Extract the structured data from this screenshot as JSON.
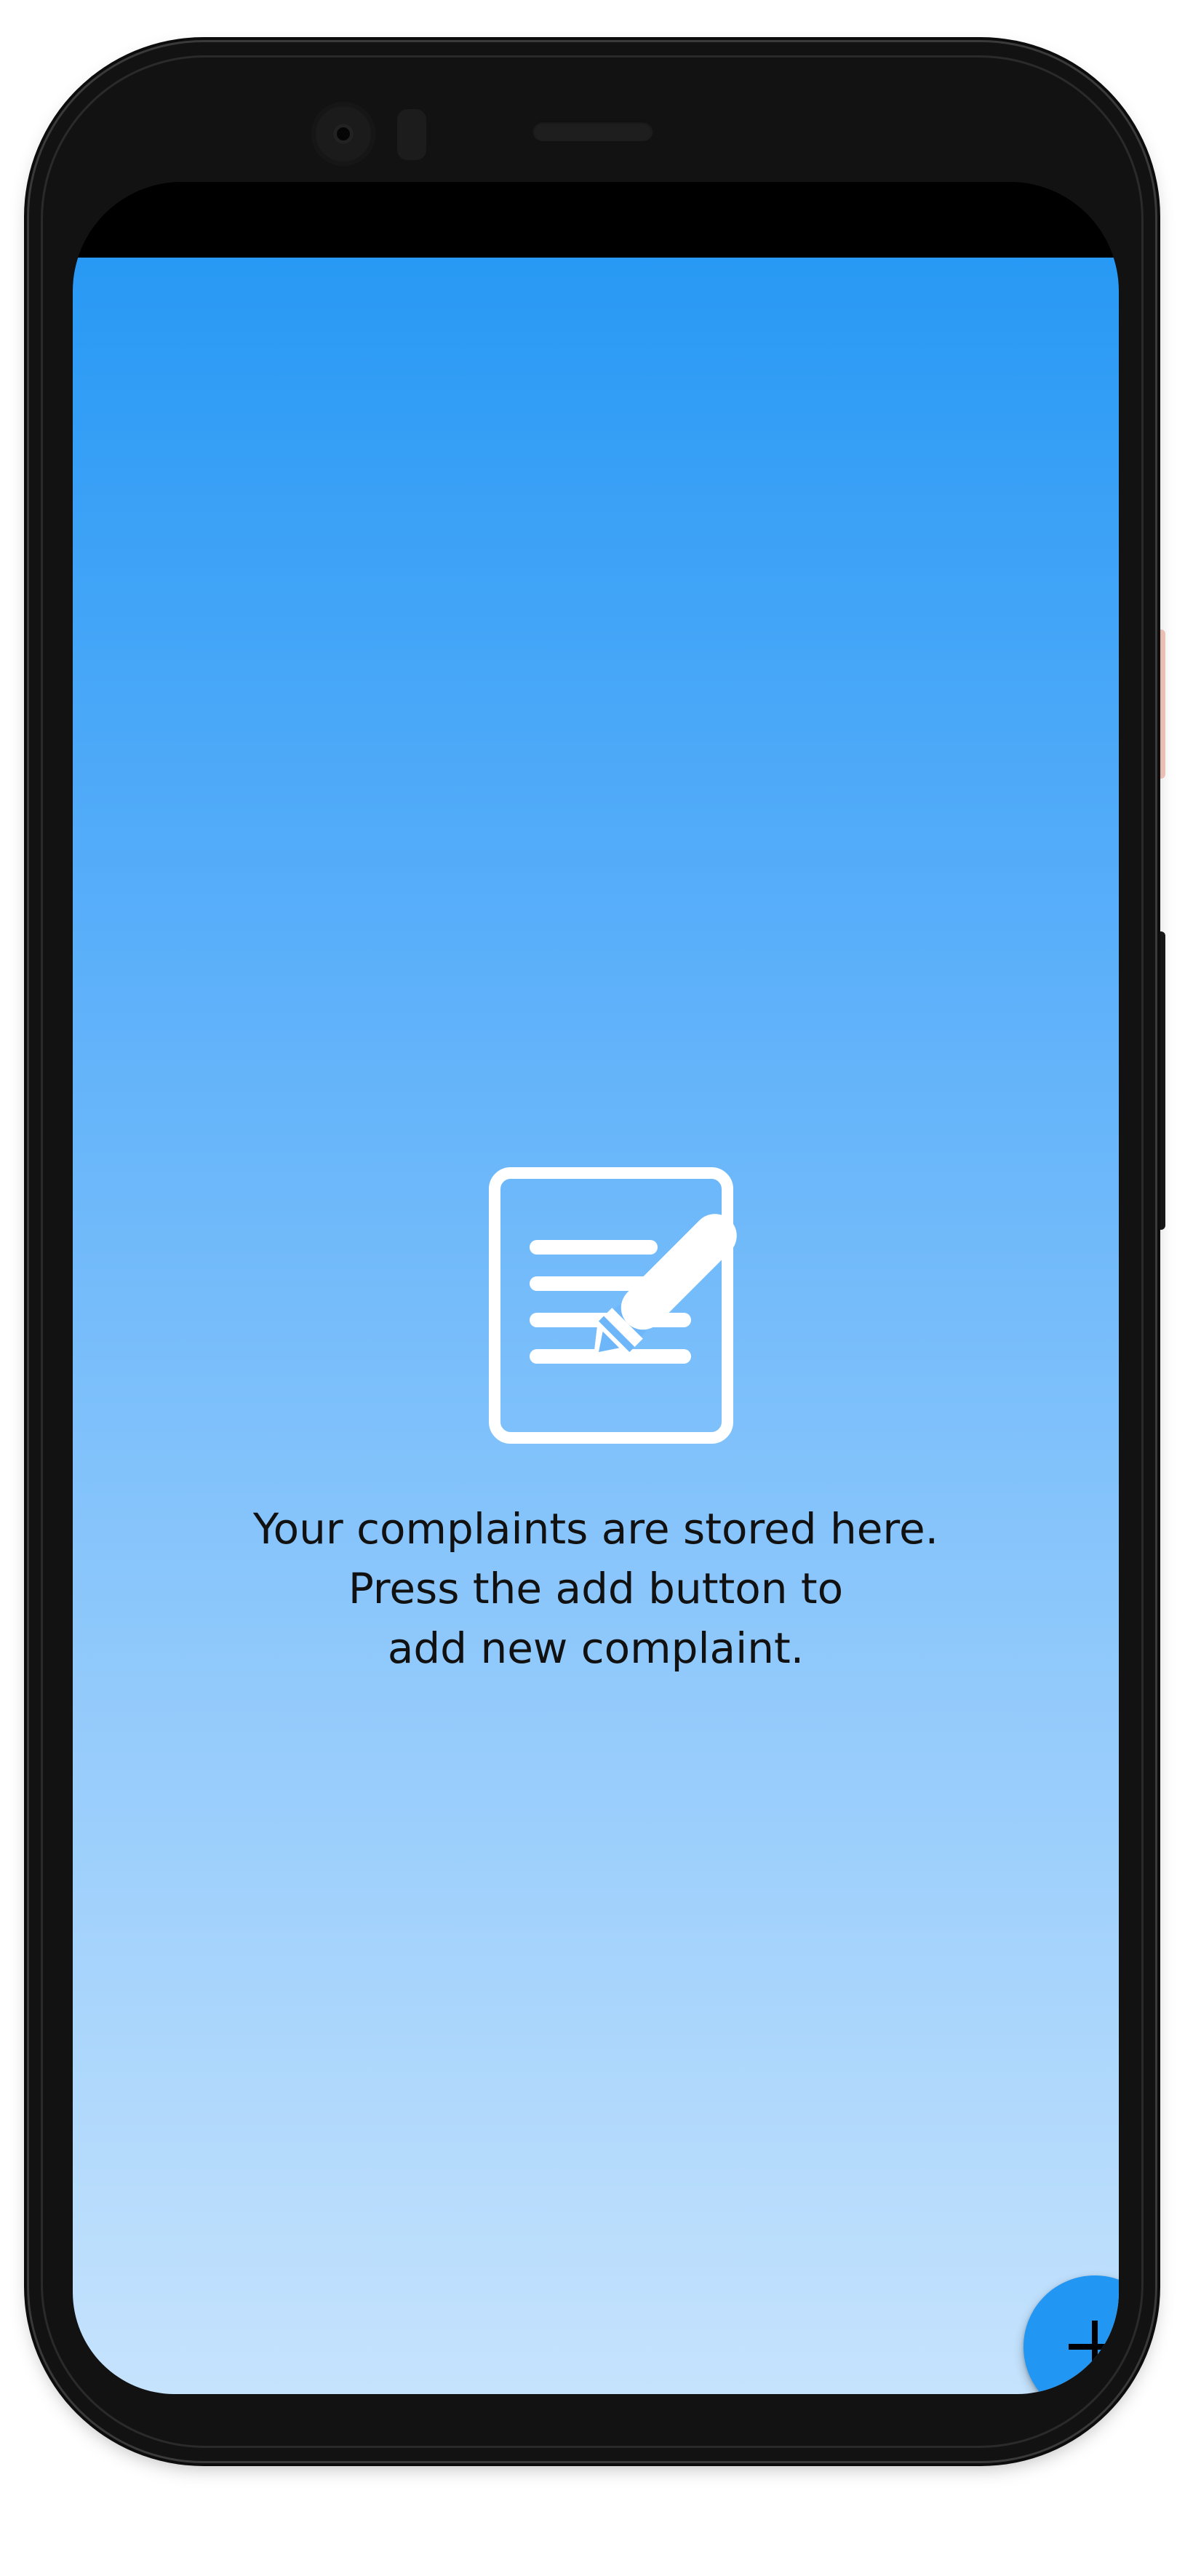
{
  "device": {
    "frame": "phone-frame",
    "colors": {
      "bezel": "#121212",
      "power_button": "#f6c9bd"
    }
  },
  "app": {
    "colors": {
      "gradient_top": "#2899f4",
      "gradient_bottom": "#c6e3fd",
      "fab": "#2196f3",
      "text": "#111111"
    },
    "empty_state": {
      "icon": "document-edit-icon",
      "lines": [
        "Your complaints are stored here.",
        "Press the add button to",
        "add new complaint."
      ]
    },
    "fab": {
      "icon": "plus-icon"
    }
  }
}
